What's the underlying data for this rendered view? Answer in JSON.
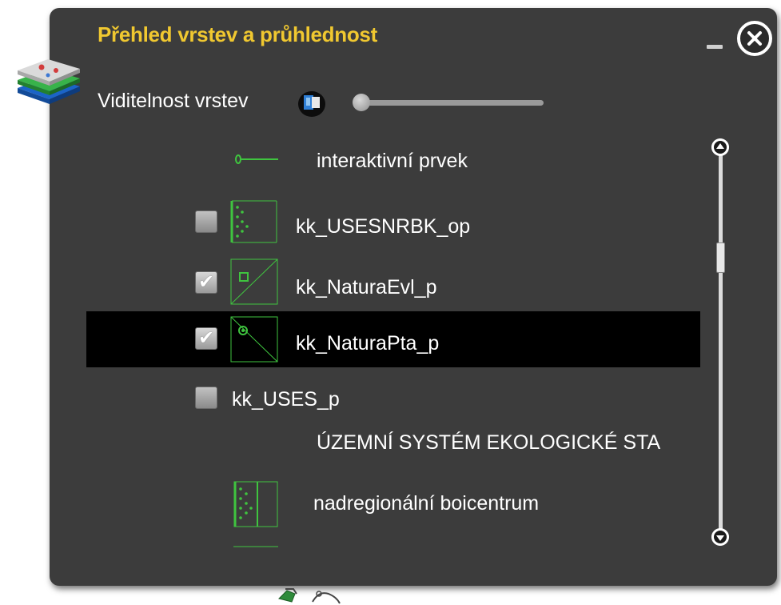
{
  "panel": {
    "title": "Přehled vrstev a průhlednost",
    "minimize_icon": "minimize-icon",
    "close_icon": "close-icon",
    "layers_icon": "layers-stack-icon"
  },
  "visibility": {
    "label": "Viditelnost vrstev",
    "icon": "layer-visibility-icon",
    "slider_value_fraction": 0.0
  },
  "legend": {
    "items": [
      {
        "type": "legend",
        "label": "interaktivní prvek",
        "icon": "point-line-symbol"
      },
      {
        "type": "layer",
        "label": "kk_USESNRBK_op",
        "checked": false,
        "icon": "dotted-hatch-symbol"
      },
      {
        "type": "layer",
        "label": "kk_NaturaEvl_p",
        "checked": true,
        "icon": "square-diagonal-symbol"
      },
      {
        "type": "layer",
        "label": "kk_NaturaPta_p",
        "checked": true,
        "selected": true,
        "icon": "circle-diagonal-symbol"
      },
      {
        "type": "layer",
        "label": "kk_USES_p",
        "checked": false
      },
      {
        "type": "heading",
        "label": "ÚZEMNÍ SYSTÉM EKOLOGICKÉ STA"
      },
      {
        "type": "legend",
        "label": "nadregionální boicentrum",
        "icon": "dotted-hatch-symbol"
      }
    ]
  },
  "scrollbar": {
    "up_icon": "scroll-up-icon",
    "down_icon": "scroll-down-icon",
    "position_fraction": 0.25
  },
  "colors": {
    "panel_bg": "#3c3c3c",
    "title": "#f0c830",
    "symbol_green": "#3fc43f",
    "selected_row": "#000000"
  }
}
